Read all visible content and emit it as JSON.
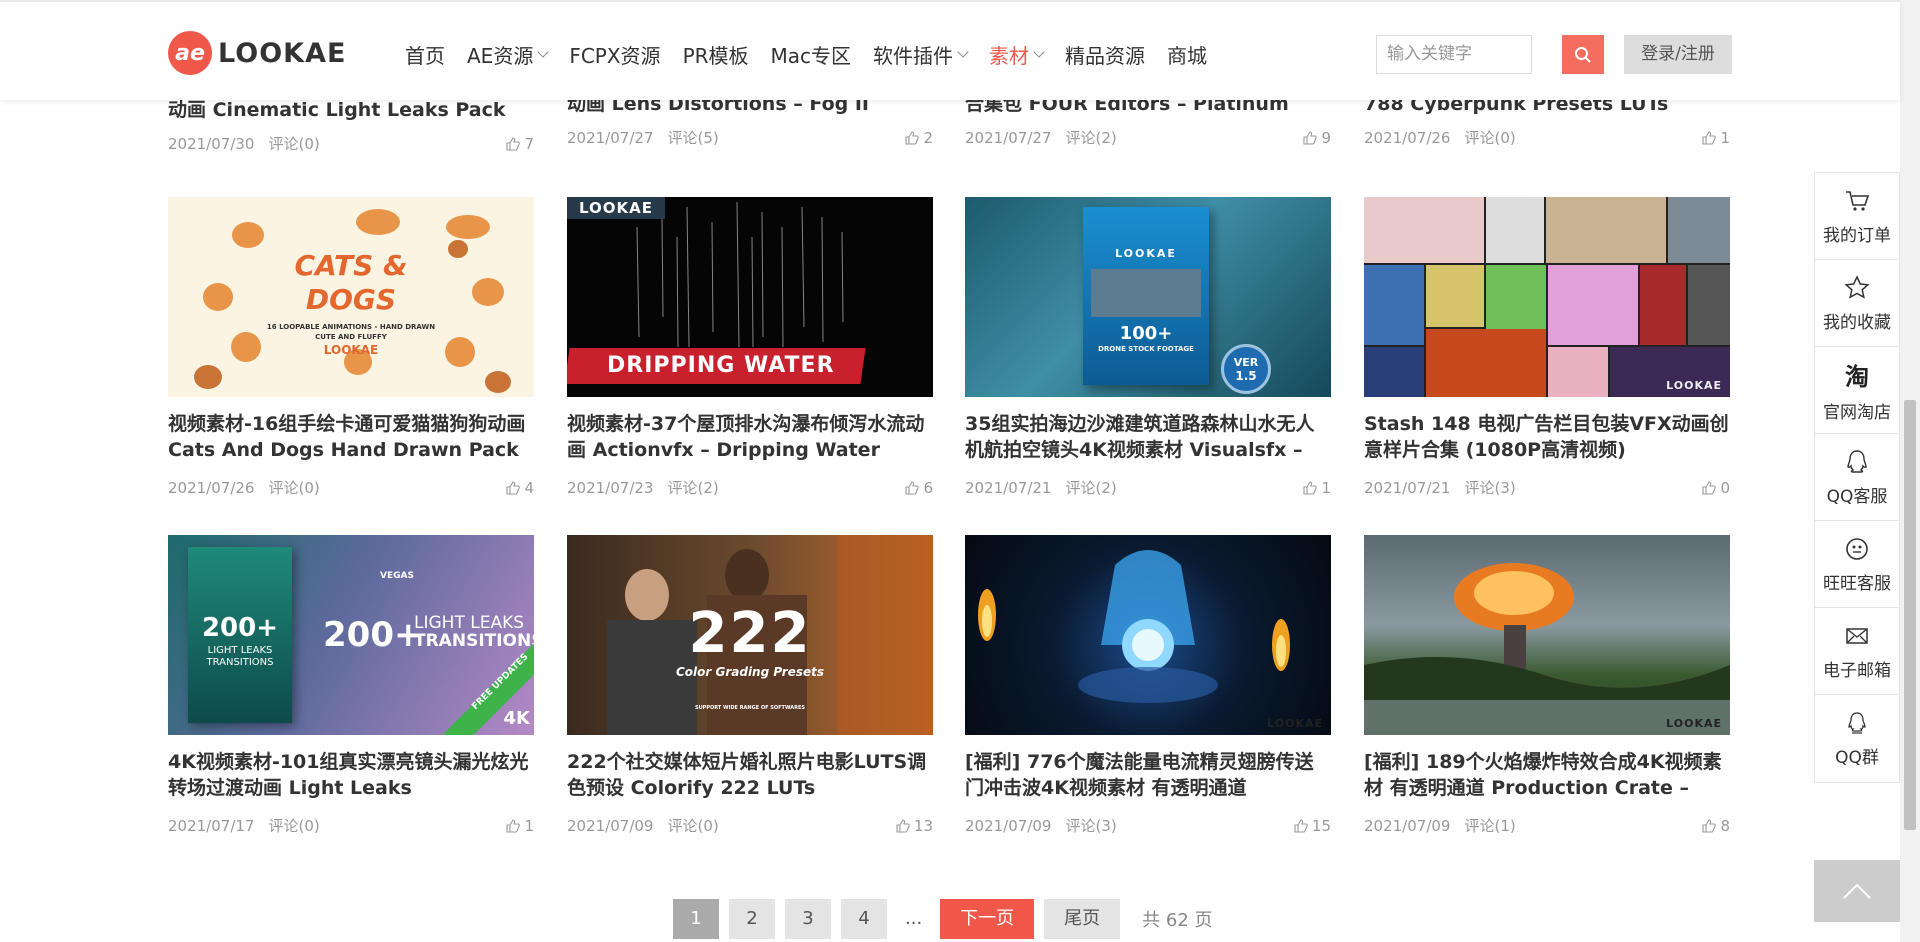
{
  "header": {
    "logo_mark": "ae",
    "logo_text": "LOOKAE",
    "nav": [
      {
        "label": "首页",
        "dropdown": false,
        "active": false
      },
      {
        "label": "AE资源",
        "dropdown": true,
        "active": false
      },
      {
        "label": "FCPX资源",
        "dropdown": false,
        "active": false
      },
      {
        "label": "PR模板",
        "dropdown": false,
        "active": false
      },
      {
        "label": "Mac专区",
        "dropdown": false,
        "active": false
      },
      {
        "label": "软件插件",
        "dropdown": true,
        "active": false
      },
      {
        "label": "素材",
        "dropdown": true,
        "active": true
      },
      {
        "label": "精品资源",
        "dropdown": false,
        "active": false
      },
      {
        "label": "商城",
        "dropdown": false,
        "active": false
      }
    ],
    "search_placeholder": "输入关键字",
    "login_label": "登录/注册"
  },
  "top_row": [
    {
      "title": "动画 Cinematic Light Leaks Pack",
      "date": "2021/07/30",
      "comments": "评论(0)",
      "likes": "7"
    },
    {
      "title": "动画 Lens Distortions – Fog II",
      "date": "2021/07/27",
      "comments": "评论(5)",
      "likes": "2"
    },
    {
      "title": "合集包 FOUR Editors – Platinum",
      "date": "2021/07/27",
      "comments": "评论(2)",
      "likes": "9"
    },
    {
      "title": "788 Cyberpunk Presets LUTs",
      "date": "2021/07/26",
      "comments": "评论(0)",
      "likes": "1"
    }
  ],
  "cards": [
    {
      "title": "视频素材-16组手绘卡通可爱猫猫狗狗动画 Cats And Dogs Hand Drawn Pack",
      "date": "2021/07/26",
      "comments": "评论(0)",
      "likes": "4",
      "thumb": {
        "line1": "CATS &",
        "line2": "DOGS",
        "sub": "16 LOOPABLE ANIMATIONS - HAND DRAWN",
        "sub2": "CUTE AND FLUFFY",
        "brand": "LOOKAE"
      }
    },
    {
      "title": "视频素材-37个屋顶排水沟瀑布倾泻水流动画 Actionvfx – Dripping Water Assets",
      "date": "2021/07/23",
      "comments": "评论(2)",
      "likes": "6",
      "thumb": {
        "badge": "LOOKAE",
        "banner": "DRIPPING WATER"
      }
    },
    {
      "title": "35组实拍海边沙滩建筑道路森林山水无人机航拍空镜头4K视频素材 Visualsfx – Drone",
      "date": "2021/07/21",
      "comments": "评论(2)",
      "likes": "1",
      "thumb": {
        "box_brand": "LOOKAE",
        "box_main": "100+",
        "box_sub": "DRONE STOCK FOOTAGE",
        "ver1": "VER",
        "ver2": "1.5"
      }
    },
    {
      "title": "Stash 148 电视广告栏目包装VFX动画创意样片合集 (1080P高清视频)",
      "date": "2021/07/21",
      "comments": "评论(3)",
      "likes": "0",
      "thumb": {
        "brand": "LOOKAE"
      }
    },
    {
      "title": "4K视频素材-101组真实漂亮镜头漏光炫光转场过渡动画 Light Leaks Transitions",
      "date": "2021/07/17",
      "comments": "评论(0)",
      "likes": "1",
      "thumb": {
        "box_main": "200+",
        "box_sub": "LIGHT LEAKS",
        "box_sub2": "TRANSITIONS",
        "big": "200+",
        "big_sub": "LIGHT LEAKS",
        "big_sub2": "TRANSITIONS",
        "apps": "VEGAS",
        "corner": "FREE UPDATES",
        "k": "4K"
      }
    },
    {
      "title": "222个社交媒体短片婚礼照片电影LUTS调色预设 Colorify 222 LUTs",
      "date": "2021/07/09",
      "comments": "评论(0)",
      "likes": "13",
      "thumb": {
        "num": "222",
        "sub": "Color Grading Presets",
        "foot": "SUPPORT WIDE RANGE OF SOFTWARES"
      }
    },
    {
      "title": "[福利] 776个魔法能量电流精灵翅膀传送门冲击波4K视频素材 有透明通道 Production",
      "date": "2021/07/09",
      "comments": "评论(3)",
      "likes": "15",
      "thumb": {
        "brand": "LOOKAE"
      }
    },
    {
      "title": "[福利] 189个火焰爆炸特效合成4K视频素材 有透明通道 Production Crate –",
      "date": "2021/07/09",
      "comments": "评论(1)",
      "likes": "8",
      "thumb": {
        "brand": "LOOKAE"
      }
    }
  ],
  "sidebar": [
    {
      "label": "我的订单",
      "icon": "cart-icon"
    },
    {
      "label": "我的收藏",
      "icon": "star-icon"
    },
    {
      "label": "官网淘店",
      "icon": "taobao-icon",
      "glyph": "淘"
    },
    {
      "label": "QQ客服",
      "icon": "qq-icon"
    },
    {
      "label": "旺旺客服",
      "icon": "wangwang-icon"
    },
    {
      "label": "电子邮箱",
      "icon": "mail-icon"
    },
    {
      "label": "QQ群",
      "icon": "qq-group-icon"
    }
  ],
  "pagination": {
    "pages": [
      "1",
      "2",
      "3",
      "4"
    ],
    "current": "1",
    "dots": "...",
    "next": "下一页",
    "last": "尾页",
    "total": "共 62 页"
  },
  "colors": {
    "accent": "#f2584a",
    "text": "#333333",
    "muted": "#999999"
  }
}
